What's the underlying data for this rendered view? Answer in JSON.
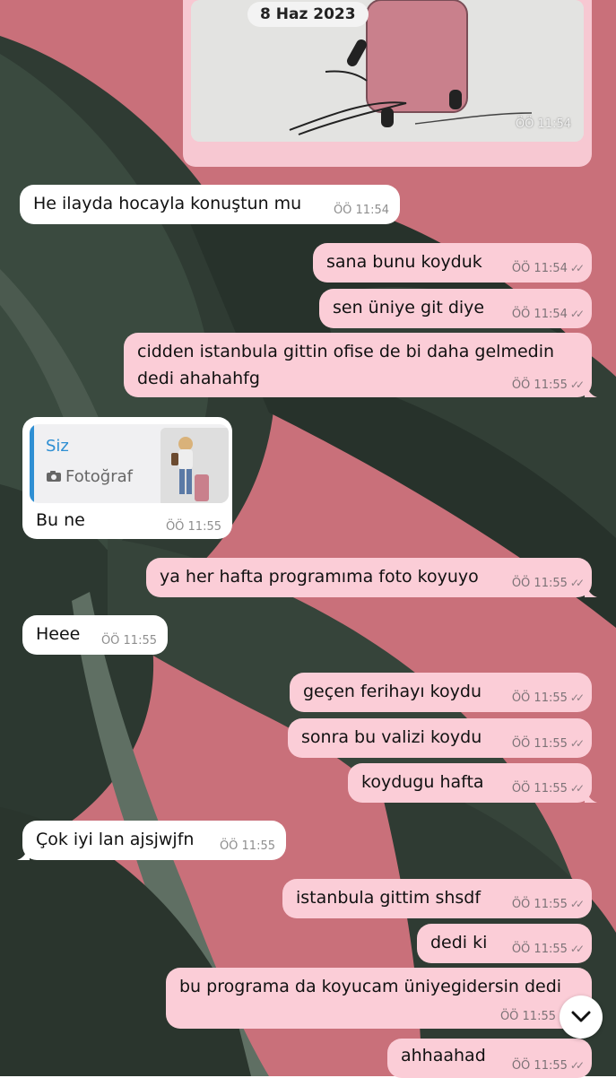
{
  "date_label": "8 Haz 2023",
  "photo": {
    "time": "ÖÖ 11:54"
  },
  "messages": [
    {
      "text": "He ilayda hocayla konuştun mu",
      "time": "ÖÖ 11:54"
    },
    {
      "text": "sana bunu koyduk",
      "time": "ÖÖ 11:54"
    },
    {
      "text": "sen üniye git diye",
      "time": "ÖÖ 11:54"
    },
    {
      "line1": "cidden istanbula gittin ofise de bi daha gelmedin",
      "line2": "dedi ahahahfg",
      "time": "ÖÖ 11:55"
    },
    {
      "reply_name": "Siz",
      "reply_type": "Fotoğraf",
      "text": "Bu ne",
      "time": "ÖÖ 11:55"
    },
    {
      "text": "ya her hafta programıma foto koyuyo",
      "time": "ÖÖ 11:55"
    },
    {
      "text": "Heee",
      "time": "ÖÖ 11:55"
    },
    {
      "text": "geçen ferihayı koydu",
      "time": "ÖÖ 11:55"
    },
    {
      "text": "sonra bu valizi koydu",
      "time": "ÖÖ 11:55"
    },
    {
      "text": "koydugu hafta",
      "time": "ÖÖ 11:55"
    },
    {
      "text": "Çok iyi lan ajsjwjfn",
      "time": "ÖÖ 11:55"
    },
    {
      "text": "istanbula gittim shsdf",
      "time": "ÖÖ 11:55"
    },
    {
      "text": "dedi ki",
      "time": "ÖÖ 11:55"
    },
    {
      "line1": "bu programa da koyucam üniyegidersin dedi",
      "time": "ÖÖ 11:55"
    },
    {
      "text": "ahhaahad",
      "time": "ÖÖ 11:55"
    }
  ],
  "colors": {
    "outgoing_bubble": "#fbcdd7",
    "incoming_bubble": "#ffffff",
    "wallpaper": "#c9707a",
    "reply_accent": "#2f8fd3"
  }
}
